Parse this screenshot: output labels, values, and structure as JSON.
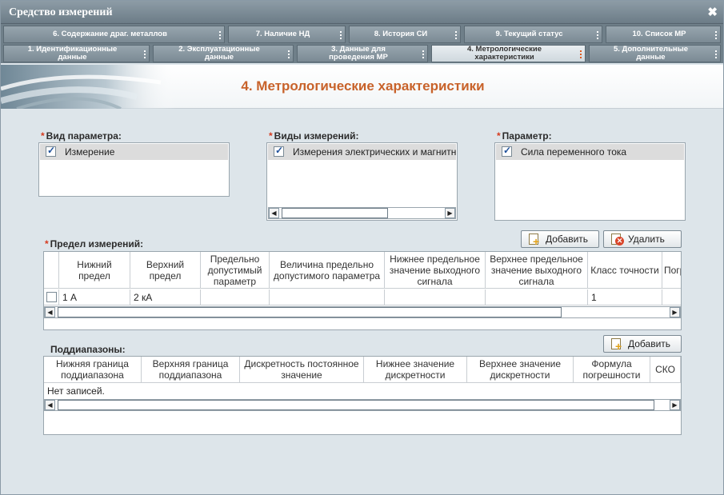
{
  "window": {
    "title": "Средство измерений",
    "close_glyph": "✖"
  },
  "tabs_row1": [
    {
      "label": "6. Содержание драг. металлов"
    },
    {
      "label": "7. Наличие НД"
    },
    {
      "label": "8. История СИ"
    },
    {
      "label": "9. Текущий статус"
    },
    {
      "label": "10. Список МР"
    }
  ],
  "tabs_row2": [
    {
      "line1": "1. Идентификационные",
      "line2": "данные"
    },
    {
      "line1": "2. Эксплуатационные",
      "line2": "данные"
    },
    {
      "line1": "3. Данные для",
      "line2": "проведения МР"
    },
    {
      "line1": "4. Метрологические",
      "line2": "характеристики",
      "active": true
    },
    {
      "line1": "5. Дополнительные",
      "line2": "данные"
    }
  ],
  "page_title": "4. Метрологические характеристики",
  "required_mark": "*",
  "param_type": {
    "label": "Вид параметра:",
    "item": "Измерение",
    "checked": true
  },
  "measure_types": {
    "label": "Виды измерений:",
    "item": "Измерения электрических и магнитных величин",
    "checked": true
  },
  "parameter": {
    "label": "Параметр:",
    "item": "Сила переменного тока",
    "checked": true
  },
  "buttons": {
    "add": "Добавить",
    "delete": "Удалить",
    "add2": "Добавить"
  },
  "limits": {
    "label": "Предел измерений:",
    "columns": [
      "Нижний предел",
      "Верхний предел",
      "Предельно допустимый параметр",
      "Величина предельно допустимого параметра",
      "Нижнее предельное значение выходного сигнала",
      "Верхнее предельное значение выходного сигнала",
      "Класс точности",
      "Погрешность"
    ],
    "rows": [
      {
        "lower": "1 А",
        "upper": "2 кА",
        "c3": "",
        "c4": "",
        "c5": "",
        "c6": "",
        "accuracy": "1",
        "c8": ""
      }
    ]
  },
  "subranges": {
    "label": "Поддиапазоны:",
    "columns": [
      "Нижняя граница поддиапазона",
      "Верхняя граница поддиапазона",
      "Дискретность постоянное значение",
      "Нижнее значение дискретности",
      "Верхнее значение дискретности",
      "Формула погрешности",
      "СКО"
    ],
    "empty_text": "Нет записей."
  },
  "scroll": {
    "left": "◀",
    "right": "▶"
  },
  "colors": {
    "title_accent": "#c8622a",
    "required": "#d63a1e",
    "window_bg": "#dde5ea"
  }
}
